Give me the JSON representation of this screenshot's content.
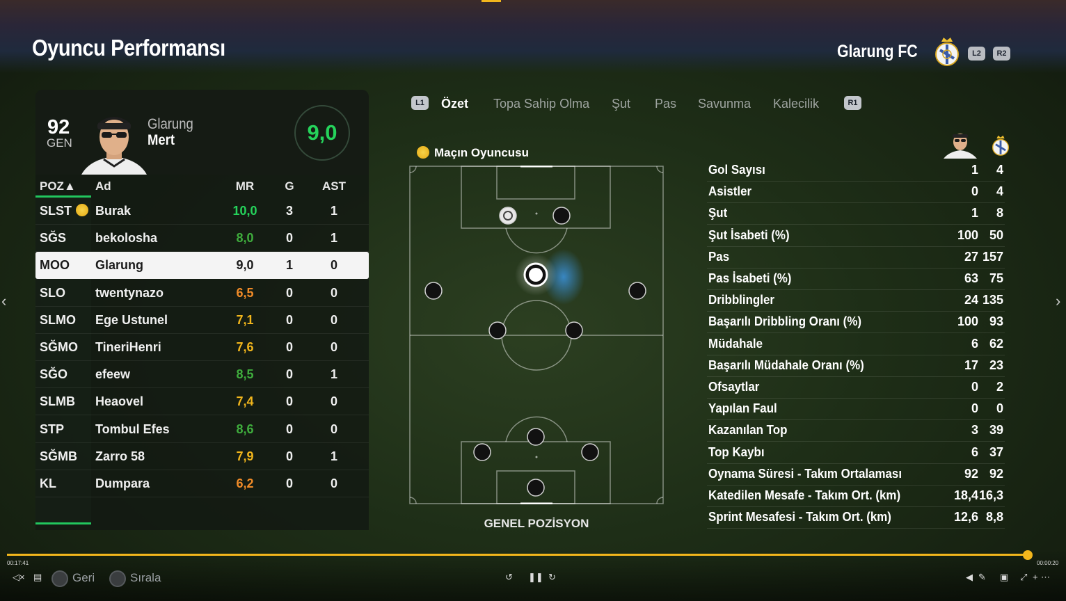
{
  "header": {
    "title": "Oyuncu Performansı",
    "team_name": "Glarung FC",
    "btn_l2": "L2",
    "btn_r2": "R2"
  },
  "player_card": {
    "ovr": "92",
    "ovr_label": "GEN",
    "first_name": "Glarung",
    "last_name": "Mert",
    "rating": "9,0"
  },
  "table": {
    "headers": {
      "pos": "POZ▲",
      "name": "Ad",
      "mr": "MR",
      "g": "G",
      "ast": "AST"
    },
    "rows": [
      {
        "pos": "SLST",
        "name": "Burak",
        "mr": "10,0",
        "g": "3",
        "ast": "1",
        "rating_color": "#25d35b",
        "motm": true
      },
      {
        "pos": "SĞS",
        "name": "bekolosha",
        "mr": "8,0",
        "g": "0",
        "ast": "1",
        "rating_color": "#3fae3d"
      },
      {
        "pos": "MOO",
        "name": "Glarung",
        "mr": "9,0",
        "g": "1",
        "ast": "0",
        "rating_color": "#1b1b1b",
        "selected": true
      },
      {
        "pos": "SLO",
        "name": "twentynazo",
        "mr": "6,5",
        "g": "0",
        "ast": "0",
        "rating_color": "#f28c28"
      },
      {
        "pos": "SLMO",
        "name": "Ege Ustunel",
        "mr": "7,1",
        "g": "0",
        "ast": "0",
        "rating_color": "#f2b61c"
      },
      {
        "pos": "SĞMO",
        "name": "TineriHenri",
        "mr": "7,6",
        "g": "0",
        "ast": "0",
        "rating_color": "#f2b61c"
      },
      {
        "pos": "SĞO",
        "name": "efeew",
        "mr": "8,5",
        "g": "0",
        "ast": "1",
        "rating_color": "#3fae3d"
      },
      {
        "pos": "SLMB",
        "name": "Heaovel",
        "mr": "7,4",
        "g": "0",
        "ast": "0",
        "rating_color": "#f2b61c"
      },
      {
        "pos": "STP",
        "name": "Tombul Efes",
        "mr": "8,6",
        "g": "0",
        "ast": "0",
        "rating_color": "#3fae3d"
      },
      {
        "pos": "SĞMB",
        "name": "Zarro 58",
        "mr": "7,9",
        "g": "0",
        "ast": "1",
        "rating_color": "#f2b61c"
      },
      {
        "pos": "KL",
        "name": "Dumpara",
        "mr": "6,2",
        "g": "0",
        "ast": "0",
        "rating_color": "#f28c28"
      }
    ]
  },
  "tabs": {
    "l1": "L1",
    "r1": "R1",
    "items": [
      "Özet",
      "Topa Sahip Olma",
      "Şut",
      "Pas",
      "Savunma",
      "Kalecilik"
    ],
    "active_index": 0
  },
  "pitch": {
    "motm_label": "Maçın Oyuncusu",
    "position_label": "GENEL POZİSYON"
  },
  "stats": [
    {
      "label": "Gol Sayısı",
      "player": "1",
      "team": "4"
    },
    {
      "label": "Asistler",
      "player": "0",
      "team": "4"
    },
    {
      "label": "Şut",
      "player": "1",
      "team": "8"
    },
    {
      "label": "Şut İsabeti (%)",
      "player": "100",
      "team": "50"
    },
    {
      "label": "Pas",
      "player": "27",
      "team": "157"
    },
    {
      "label": "Pas İsabeti (%)",
      "player": "63",
      "team": "75"
    },
    {
      "label": "Dribblingler",
      "player": "24",
      "team": "135"
    },
    {
      "label": "Başarılı Dribbling Oranı (%)",
      "player": "100",
      "team": "93"
    },
    {
      "label": "Müdahale",
      "player": "6",
      "team": "62"
    },
    {
      "label": "Başarılı Müdahale Oranı (%)",
      "player": "17",
      "team": "23"
    },
    {
      "label": "Ofsaytlar",
      "player": "0",
      "team": "2"
    },
    {
      "label": "Yapılan Faul",
      "player": "0",
      "team": "0"
    },
    {
      "label": "Kazanılan Top",
      "player": "3",
      "team": "39"
    },
    {
      "label": "Top Kaybı",
      "player": "6",
      "team": "37"
    },
    {
      "label": "Oynama Süresi - Takım Ortalaması",
      "player": "92",
      "team": "92"
    },
    {
      "label": "Katedilen Mesafe - Takım Ort. (km)",
      "player": "18,4",
      "team": "16,3"
    },
    {
      "label": "Sprint Mesafesi - Takım Ort. (km)",
      "player": "12,6",
      "team": "8,8"
    }
  ],
  "media": {
    "time_elapsed": "00:17:41",
    "time_remaining": "00:00:20",
    "progress": 0.995,
    "back_label": "Geri",
    "sort_label": "Sırala"
  },
  "colors": {
    "accent_green": "#25d35b",
    "progress": "#f2b61c"
  }
}
